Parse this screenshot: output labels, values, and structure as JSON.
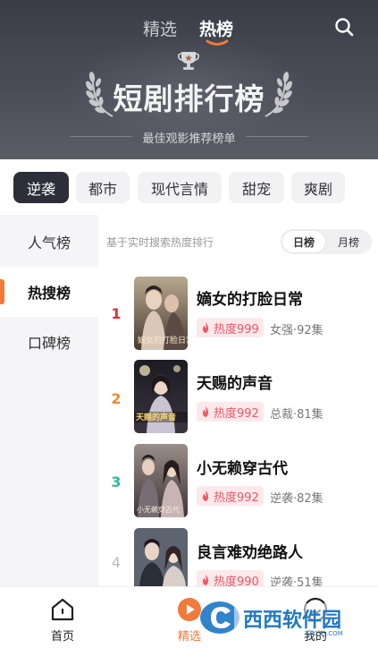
{
  "header": {
    "tabs": [
      {
        "label": "精选",
        "active": false
      },
      {
        "label": "热榜",
        "active": true
      }
    ],
    "search_icon": "search-icon",
    "banner_title": "短剧排行榜",
    "banner_subtitle": "最佳观影推荐榜单"
  },
  "genres": [
    {
      "label": "逆袭",
      "active": true
    },
    {
      "label": "都市",
      "active": false
    },
    {
      "label": "现代言情",
      "active": false
    },
    {
      "label": "甜宠",
      "active": false
    },
    {
      "label": "爽剧",
      "active": false
    }
  ],
  "sidebar": {
    "items": [
      {
        "label": "人气榜",
        "active": false
      },
      {
        "label": "热搜榜",
        "active": true
      },
      {
        "label": "口碑榜",
        "active": false
      }
    ]
  },
  "list_hint": "基于实时搜索热度排行",
  "period_toggle": [
    {
      "label": "日榜",
      "active": true
    },
    {
      "label": "月榜",
      "active": false
    }
  ],
  "dramas": [
    {
      "rank": "1",
      "rank_color": "#e0303a",
      "title": "嫡女的打脸日常",
      "heat": "热度999",
      "meta": "女强·92集",
      "poster_text": "嫡女的打脸日常"
    },
    {
      "rank": "2",
      "rank_color": "#ef8a2a",
      "title": "天赐的声音",
      "heat": "热度992",
      "meta": "总裁·81集",
      "poster_text": "天赐的声音"
    },
    {
      "rank": "3",
      "rank_color": "#2fb89a",
      "title": "小无赖穿古代",
      "heat": "热度992",
      "meta": "逆袭·82集",
      "poster_text": "小无赖穿古代"
    },
    {
      "rank": "4",
      "rank_color": "#bbbbbb",
      "title": "良言难劝绝路人",
      "heat": "热度990",
      "meta": "逆袭·51集",
      "poster_text": ""
    }
  ],
  "bottom_nav": [
    {
      "label": "首页",
      "icon": "home-icon",
      "active": false
    },
    {
      "label": "精选",
      "icon": "play-icon",
      "active": true
    },
    {
      "label": "我的",
      "icon": "profile-icon",
      "active": false
    }
  ],
  "watermark_text": "西西软件园",
  "watermark_url": "CR173.COM",
  "colors": {
    "accent": "#f07a3a",
    "heat_text": "#f0566a",
    "heat_bg": "#fde8ea",
    "header_bg": "#3d4049"
  }
}
